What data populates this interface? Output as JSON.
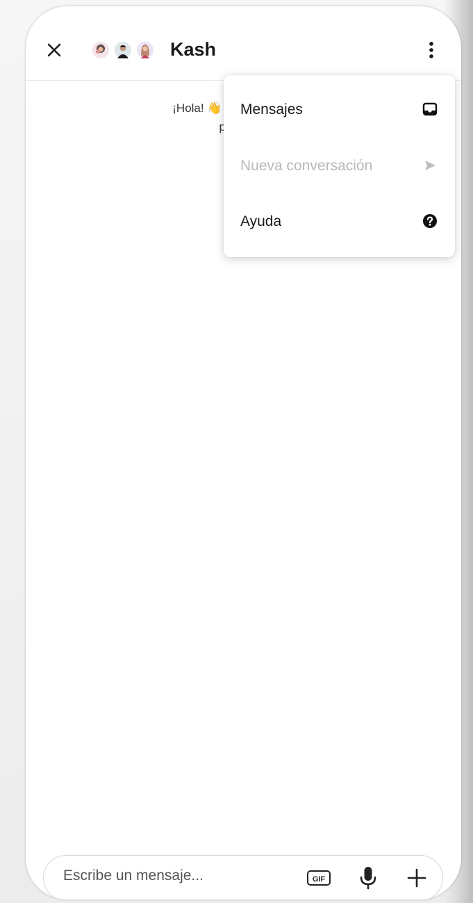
{
  "header": {
    "title": "Kash",
    "avatars": [
      "avatar-1",
      "avatar-2",
      "avatar-3"
    ]
  },
  "welcome": {
    "line1": "¡Hola! 👋 Bienvenido al Ce",
    "line2": "podemos"
  },
  "menu": {
    "items": [
      {
        "label": "Mensajes",
        "icon": "inbox-icon",
        "disabled": false
      },
      {
        "label": "Nueva conversación",
        "icon": "send-icon",
        "disabled": true
      },
      {
        "label": "Ayuda",
        "icon": "help-icon",
        "disabled": false
      }
    ]
  },
  "composer": {
    "placeholder": "Escribe un mensaje...",
    "gif_label": "GIF"
  },
  "colors": {
    "text": "#1a1a1a",
    "disabled": "#b8b8b8",
    "border": "#d6d6d6"
  }
}
